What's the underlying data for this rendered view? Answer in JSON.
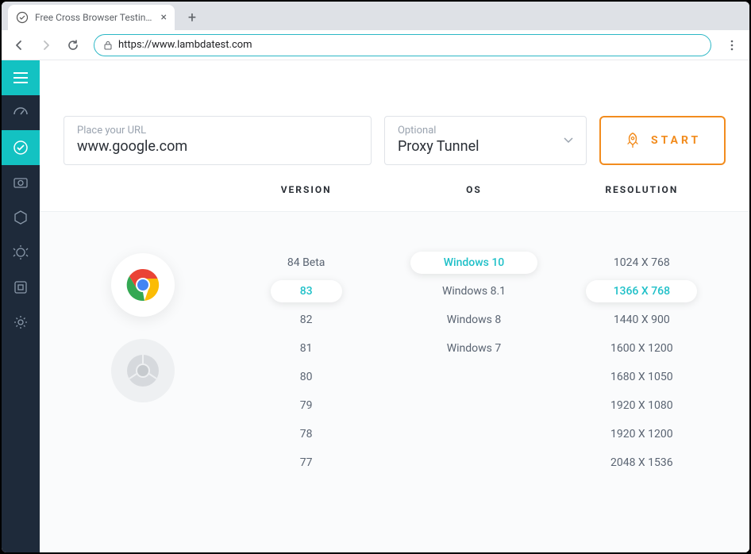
{
  "browser": {
    "tab_title": "Free Cross Browser Testing Clou",
    "url": "https://www.lambdatest.com"
  },
  "form": {
    "url_label": "Place your URL",
    "url_value": "www.google.com",
    "proxy_label": "Optional",
    "proxy_value": "Proxy Tunnel",
    "start_label": "START"
  },
  "headers": {
    "version": "VERSION",
    "os": "OS",
    "resolution": "RESOLUTION"
  },
  "versions": [
    "84 Beta",
    "83",
    "82",
    "81",
    "80",
    "79",
    "78",
    "77"
  ],
  "version_selected": "83",
  "os_list": [
    "Windows 10",
    "Windows 8.1",
    "Windows 8",
    "Windows 7"
  ],
  "os_selected": "Windows 10",
  "resolutions": [
    "1024 X 768",
    "1366 X 768",
    "1440 X 900",
    "1600 X 1200",
    "1680 X 1050",
    "1920 X 1080",
    "1920 X 1200",
    "2048 X 1536"
  ],
  "resolution_selected": "1366 X 768"
}
